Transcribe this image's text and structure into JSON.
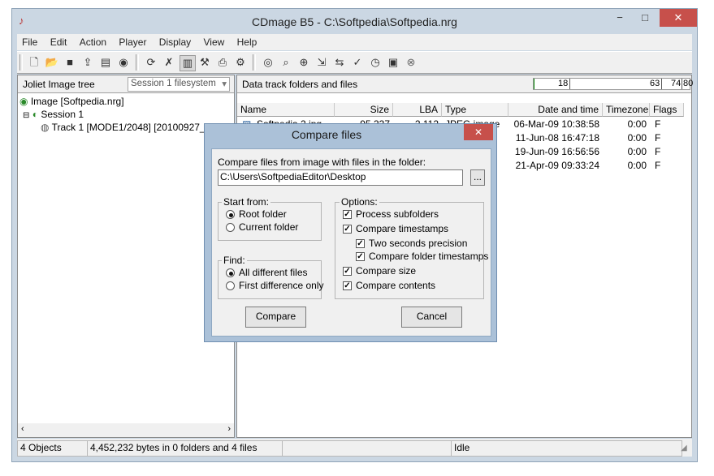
{
  "window": {
    "title": "CDmage B5 - C:\\Softpedia\\Softpedia.nrg",
    "minimize": "−",
    "maximize": "□",
    "close": "✕"
  },
  "menu": [
    "File",
    "Edit",
    "Action",
    "Player",
    "Display",
    "View",
    "Help"
  ],
  "left_panel": {
    "title": "Joliet Image tree",
    "filesystem_combo": "Session 1 filesystem",
    "tree": [
      {
        "label": "Image [Softpedia.nrg]"
      },
      {
        "label": "Session 1"
      },
      {
        "label": "Track  1 [MODE1/2048] [20100927_01532"
      }
    ]
  },
  "right_panel": {
    "title": "Data track folders and files",
    "progress_values": [
      "18",
      "63",
      "74",
      "80"
    ],
    "columns": [
      "Name",
      "Size",
      "LBA",
      "Type",
      "Date and time",
      "Timezone",
      "Flags"
    ],
    "rows": [
      {
        "name": "Softpedia 2.jpg",
        "size": "95,337",
        "lba": "2,112",
        "type": "JPEG image",
        "date": "06-Mar-09 10:38:58",
        "tz": "0:00",
        "flags": "F"
      },
      {
        "name": "",
        "size": "",
        "lba": "",
        "type": "",
        "date": "11-Jun-08 16:47:18",
        "tz": "0:00",
        "flags": "F"
      },
      {
        "name": "",
        "size": "",
        "lba": "",
        "type": "",
        "date": "19-Jun-09 16:56:56",
        "tz": "0:00",
        "flags": "F"
      },
      {
        "name": "",
        "size": "",
        "lba": "",
        "type": "",
        "date": "21-Apr-09 09:33:24",
        "tz": "0:00",
        "flags": "F"
      }
    ]
  },
  "status": {
    "objects": "4 Objects",
    "bytes": "4,452,232 bytes in 0 folders and 4 files",
    "state": "Idle"
  },
  "dialog": {
    "title": "Compare files",
    "close": "✕",
    "folder_label": "Compare files from image with files in the folder:",
    "folder_value": "C:\\Users\\SoftpediaEditor\\Desktop",
    "browse": "...",
    "start_from": {
      "label": "Start from:",
      "options": [
        {
          "label": "Root folder",
          "selected": true
        },
        {
          "label": "Current folder",
          "selected": false
        }
      ]
    },
    "find": {
      "label": "Find:",
      "options": [
        {
          "label": "All different files",
          "selected": true
        },
        {
          "label": "First difference only",
          "selected": false
        }
      ]
    },
    "options": {
      "label": "Options:",
      "items": [
        {
          "label": "Process subfolders",
          "checked": true
        },
        {
          "label": "Compare timestamps",
          "checked": true
        },
        {
          "label": "Two seconds precision",
          "checked": true
        },
        {
          "label": "Compare folder timestamps",
          "checked": true
        },
        {
          "label": "Compare size",
          "checked": true
        },
        {
          "label": "Compare contents",
          "checked": true
        }
      ]
    },
    "compare_button": "Compare",
    "cancel_button": "Cancel"
  }
}
